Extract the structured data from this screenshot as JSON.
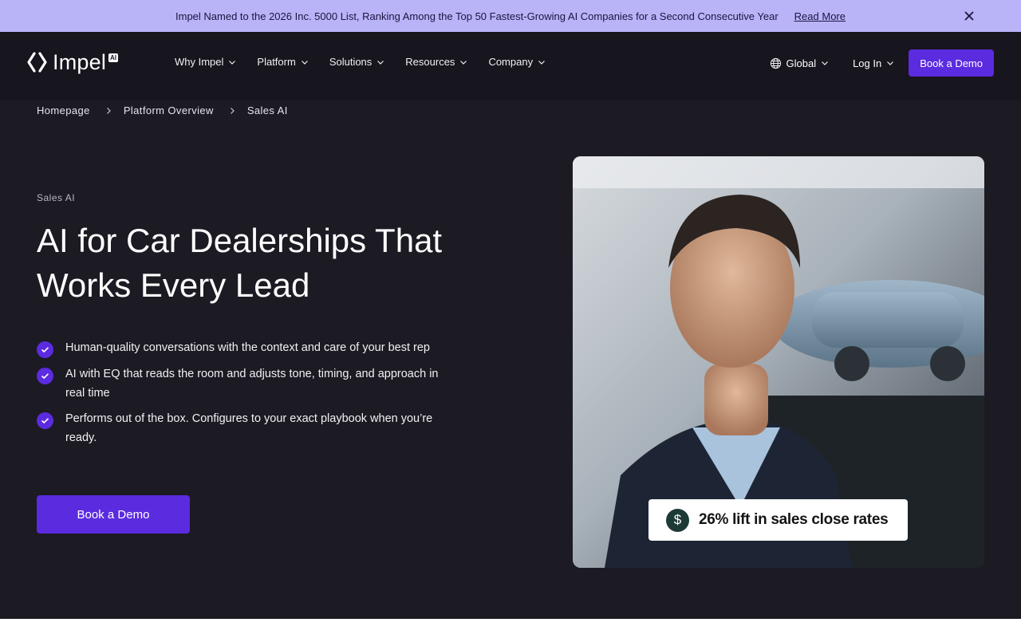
{
  "announcement": {
    "message": "Impel Named to the 2026 Inc. 5000 List, Ranking Among the Top 50 Fastest-Growing AI Companies for a Second Consecutive Year",
    "link_label": "Read More",
    "close_icon": "close-icon"
  },
  "nav": {
    "logo_word": "Impel",
    "logo_badge": "AI",
    "menu": [
      {
        "label": "Why Impel"
      },
      {
        "label": "Platform"
      },
      {
        "label": "Solutions"
      },
      {
        "label": "Resources"
      },
      {
        "label": "Company"
      }
    ],
    "region_label": "Global",
    "login_label": "Log In",
    "demo_label": "Book a Demo"
  },
  "breadcrumb": [
    "Homepage",
    "Platform Overview",
    "Sales AI"
  ],
  "hero": {
    "eyebrow": "Sales AI",
    "headline": "AI for Car Dealerships That Works Every Lead",
    "bullets": [
      "Human-quality conversations with the context and care of your best rep",
      "AI with EQ that reads the room and adjusts tone, timing, and approach in real time",
      "Performs out of the box. Configures to your exact playbook when you’re ready."
    ],
    "cta_label": "Book a Demo"
  },
  "stat_card": {
    "icon": "dollar-icon",
    "symbol": "$",
    "text": "26% lift in sales close rates"
  },
  "colors": {
    "background": "#1c1a23",
    "announcement_bg": "#b9b3f7",
    "accent": "#5b2be0",
    "stat_icon_bg": "#1e3a36"
  }
}
